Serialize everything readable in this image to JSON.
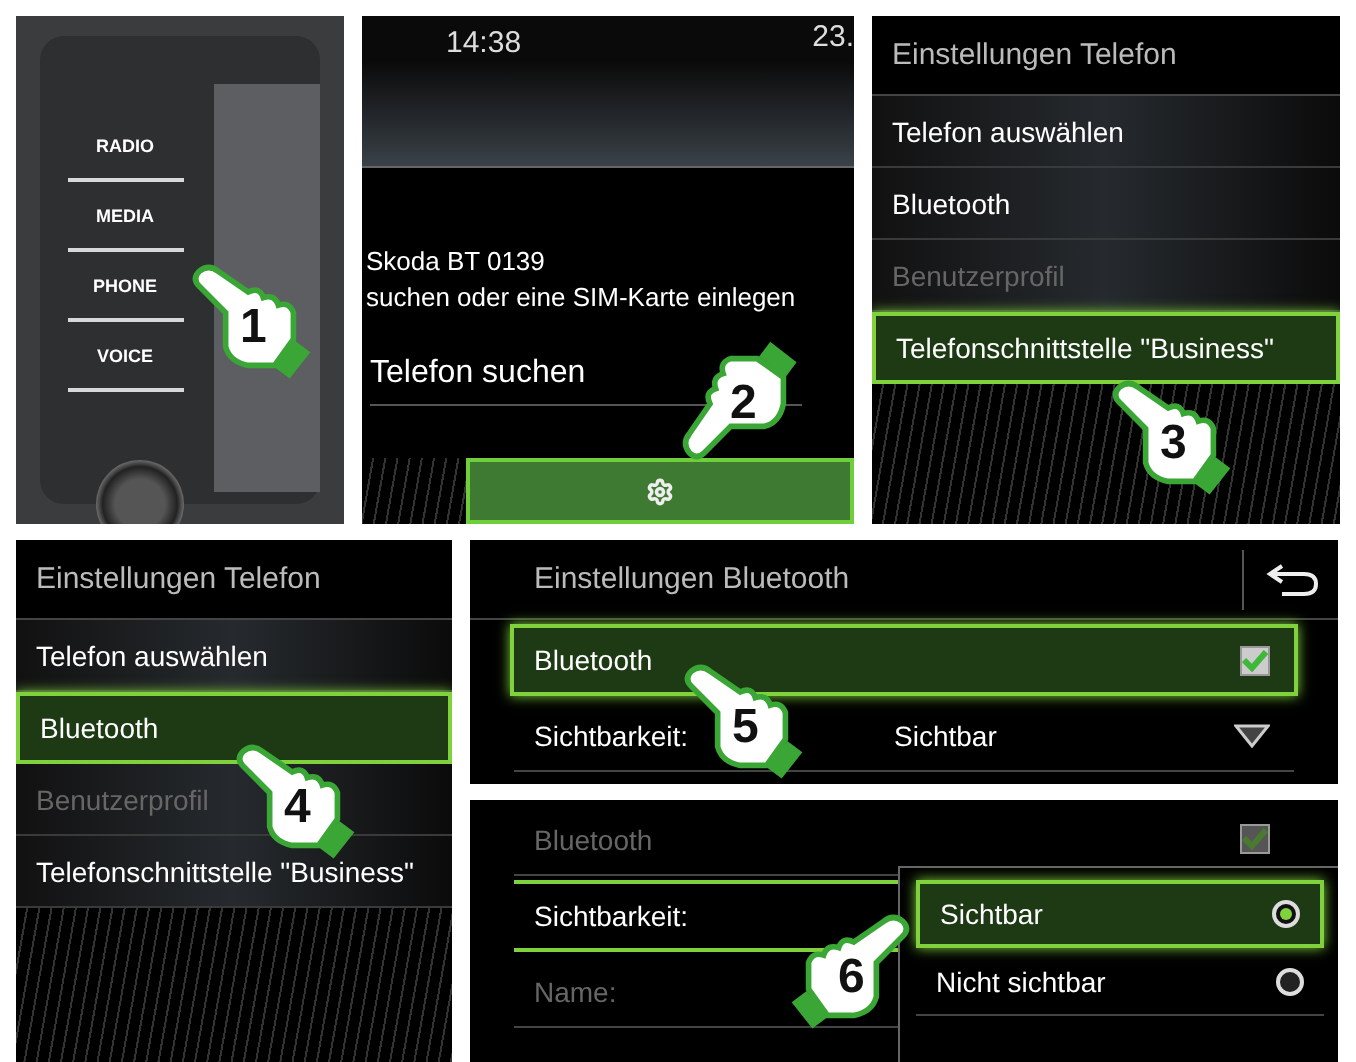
{
  "hardware_panel": {
    "step": "1",
    "buttons": [
      "RADIO",
      "MEDIA",
      "PHONE",
      "VOICE"
    ]
  },
  "phone_screen": {
    "step": "2",
    "time": "14:38",
    "date": "23.",
    "message": [
      "Skoda BT 0139",
      "suchen oder eine SIM-Karte einlegen"
    ],
    "action": "Telefon suchen"
  },
  "phone_settings_a": {
    "step": "3",
    "title": "Einstellungen Telefon",
    "items": [
      {
        "label": "Telefon auswählen",
        "selected": false,
        "disabled": false
      },
      {
        "label": "Bluetooth",
        "selected": false,
        "disabled": false
      },
      {
        "label": "Benutzerprofil",
        "selected": false,
        "disabled": true
      },
      {
        "label": "Telefonschnittstelle \"Business\"",
        "selected": true,
        "disabled": false
      }
    ]
  },
  "phone_settings_b": {
    "step": "4",
    "title": "Einstellungen Telefon",
    "items": [
      {
        "label": "Telefon auswählen",
        "selected": false,
        "disabled": false
      },
      {
        "label": "Bluetooth",
        "selected": true,
        "disabled": false
      },
      {
        "label": "Benutzerprofil",
        "selected": false,
        "disabled": true
      },
      {
        "label": "Telefonschnittstelle \"Business\"",
        "selected": false,
        "disabled": false
      }
    ]
  },
  "bluetooth_settings": {
    "step": "5",
    "title": "Einstellungen Bluetooth",
    "rows": [
      {
        "kind": "checkbox",
        "label": "Bluetooth",
        "checked": true,
        "selected": true,
        "disabled": false
      },
      {
        "kind": "dropdown",
        "label": "Sichtbarkeit:",
        "value": "Sichtbar",
        "selected": false,
        "disabled": false
      }
    ]
  },
  "bluetooth_visibility": {
    "step": "6",
    "rows": [
      {
        "kind": "checkbox",
        "label": "Bluetooth",
        "checked": true,
        "selected": false,
        "disabled": true
      },
      {
        "kind": "dropdown",
        "label": "Sichtbarkeit:",
        "selected": true,
        "disabled": false
      },
      {
        "kind": "text",
        "label": "Name:",
        "selected": false,
        "disabled": true
      }
    ],
    "options": [
      {
        "label": "Sichtbar",
        "selected": true
      },
      {
        "label": "Nicht sichtbar",
        "selected": false
      }
    ]
  }
}
